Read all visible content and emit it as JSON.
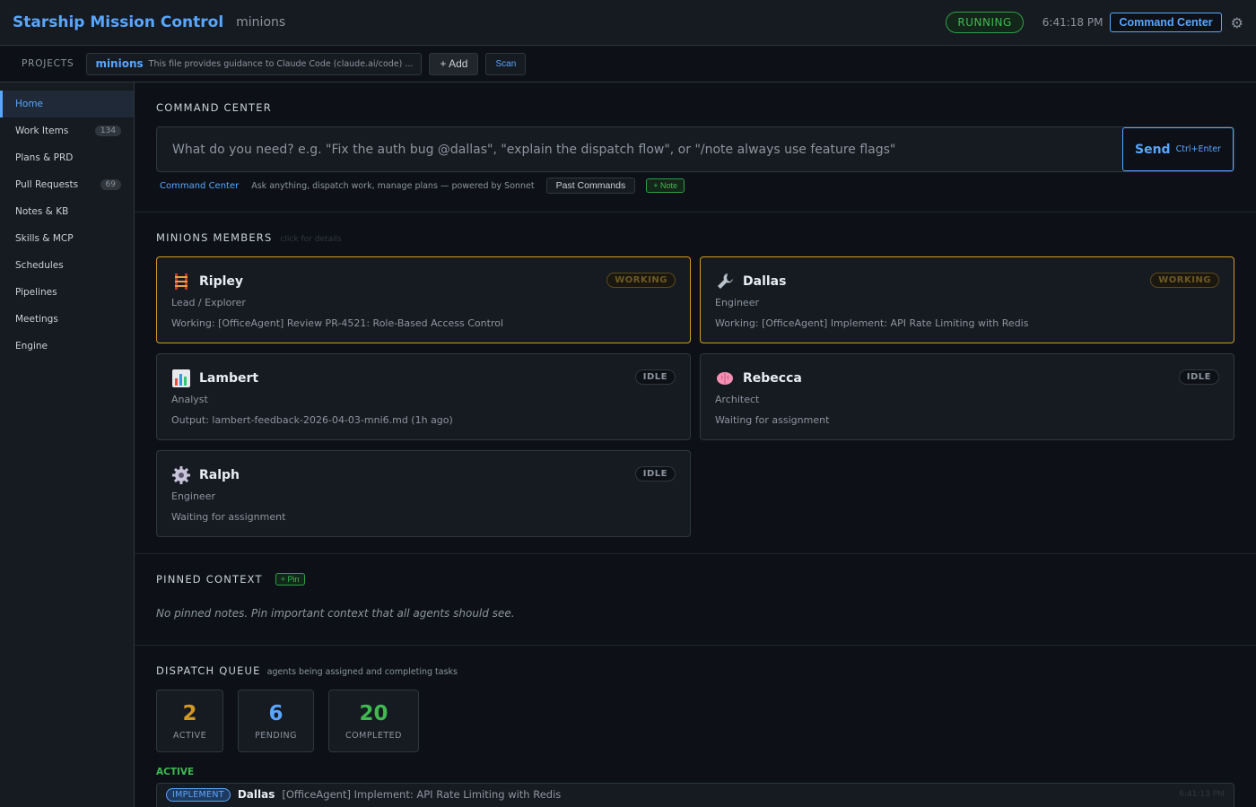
{
  "app": {
    "title": "Starship Mission Control",
    "project": "minions",
    "status": "RUNNING",
    "time": "6:41:18 PM",
    "command_center_button": "Command Center",
    "gear_icon": "⚙"
  },
  "projects": {
    "label": "PROJECTS",
    "active_name": "minions",
    "active_desc": "This file provides guidance to Claude Code (claude.ai/code) ...",
    "add_label": "+ Add",
    "scan_label": "Scan"
  },
  "sidebar": {
    "items": [
      {
        "label": "Home",
        "count": null
      },
      {
        "label": "Work Items",
        "count": "134"
      },
      {
        "label": "Plans & PRD",
        "count": null
      },
      {
        "label": "Pull Requests",
        "count": "69"
      },
      {
        "label": "Notes & KB",
        "count": null
      },
      {
        "label": "Skills & MCP",
        "count": null
      },
      {
        "label": "Schedules",
        "count": null
      },
      {
        "label": "Pipelines",
        "count": null
      },
      {
        "label": "Meetings",
        "count": null
      },
      {
        "label": "Engine",
        "count": null
      }
    ]
  },
  "command_center": {
    "title": "COMMAND CENTER",
    "placeholder": "What do you need? e.g. \"Fix the auth bug @dallas\", \"explain the dispatch flow\", or \"/note always use feature flags\"",
    "send_label": "Send",
    "send_hint": "Ctrl+Enter",
    "link": "Command Center",
    "desc": "Ask anything, dispatch work, manage plans — powered by Sonnet",
    "past_label": "Past Commands",
    "note_label": "+ Note"
  },
  "members": {
    "title": "MINIONS MEMBERS",
    "hint": "click for details",
    "cards": [
      {
        "name": "Ripley",
        "role": "Lead / Explorer",
        "task": "Working: [OfficeAgent] Review PR-4521: Role-Based Access Control",
        "status": "WORKING",
        "icon": "ladder-icon"
      },
      {
        "name": "Dallas",
        "role": "Engineer",
        "task": "Working: [OfficeAgent] Implement: API Rate Limiting with Redis",
        "status": "WORKING",
        "icon": "wrench-icon"
      },
      {
        "name": "Lambert",
        "role": "Analyst",
        "task": "Output: lambert-feedback-2026-04-03-mni6.md (1h ago)",
        "status": "IDLE",
        "icon": "bar-chart-icon"
      },
      {
        "name": "Rebecca",
        "role": "Architect",
        "task": "Waiting for assignment",
        "status": "IDLE",
        "icon": "brain-icon"
      },
      {
        "name": "Ralph",
        "role": "Engineer",
        "task": "Waiting for assignment",
        "status": "IDLE",
        "icon": "gear-icon"
      }
    ]
  },
  "pinned": {
    "title": "PINNED CONTEXT",
    "pin_label": "+ Pin",
    "empty": "No pinned notes. Pin important context that all agents should see."
  },
  "dispatch": {
    "title": "DISPATCH QUEUE",
    "hint": "agents being assigned and completing tasks",
    "stats": [
      {
        "value": "2",
        "label": "ACTIVE",
        "color": "#d29922"
      },
      {
        "value": "6",
        "label": "PENDING",
        "color": "#58a6ff"
      },
      {
        "value": "20",
        "label": "COMPLETED",
        "color": "#3fb950"
      }
    ],
    "active_label": "ACTIVE",
    "active_items": [
      {
        "type": "IMPLEMENT",
        "agent": "Dallas",
        "task": "[OfficeAgent] Implement: API Rate Limiting with Redis",
        "time": "6:41:13 PM"
      }
    ]
  }
}
